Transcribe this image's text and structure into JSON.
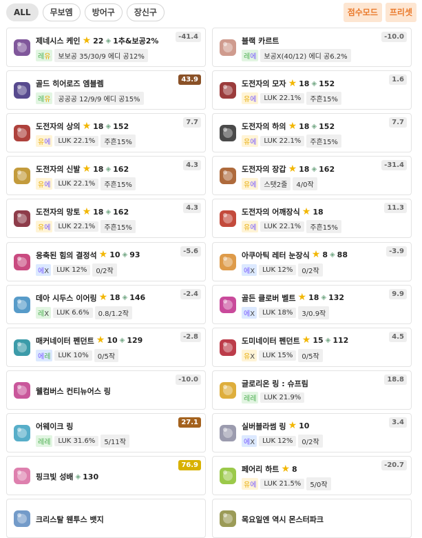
{
  "tabs": [
    "ALL",
    "무보엠",
    "방어구",
    "장신구"
  ],
  "modes": [
    "점수모드",
    "프리셋"
  ],
  "items": [
    {
      "name": "제네시스 케인",
      "stars": "22",
      "gem": "1추&보공2%",
      "pot_l": "레",
      "pot_r": "유",
      "chips": [
        "보보공 35/30/9 에디 공12%"
      ],
      "score": "-41.4",
      "scoreStyle": "",
      "icon": "cane-icon",
      "iconColor": "#6a3a8a"
    },
    {
      "name": "블랙 카르트",
      "stars": "",
      "gem": "",
      "pot_l": "레",
      "pot_r": "에",
      "chips": [
        "보공X(40/12) 에디 공6.2%"
      ],
      "score": "-10.0",
      "scoreStyle": "",
      "icon": "card-icon",
      "iconColor": "#c78a7a"
    },
    {
      "name": "골드 히어로즈 엠블렘",
      "stars": "",
      "gem": "",
      "pot_l": "레",
      "pot_r": "유",
      "chips": [
        "공공공 12/9/9 에디 공15%"
      ],
      "score": "43.9",
      "scoreStyle": "hi1",
      "icon": "emblem-icon",
      "iconColor": "#3a2a7a"
    },
    {
      "name": "도전자의 모자",
      "stars": "18",
      "gem": "152",
      "pot_l": "유",
      "pot_r": "에",
      "chips": [
        "LUK 22.1%",
        "주흔15%"
      ],
      "score": "1.6",
      "scoreStyle": "",
      "icon": "hat-icon",
      "iconColor": "#8a1a1a"
    },
    {
      "name": "도전자의 상의",
      "stars": "18",
      "gem": "152",
      "pot_l": "유",
      "pot_r": "에",
      "chips": [
        "LUK 22.1%",
        "주흔15%"
      ],
      "score": "7.7",
      "scoreStyle": "",
      "icon": "top-icon",
      "iconColor": "#a0201a"
    },
    {
      "name": "도전자의 하의",
      "stars": "18",
      "gem": "152",
      "pot_l": "유",
      "pot_r": "에",
      "chips": [
        "LUK 22.1%",
        "주흔15%"
      ],
      "score": "7.7",
      "scoreStyle": "",
      "icon": "bottom-icon",
      "iconColor": "#2a2a2a"
    },
    {
      "name": "도전자의 신발",
      "stars": "18",
      "gem": "162",
      "pot_l": "유",
      "pot_r": "에",
      "chips": [
        "LUK 22.1%",
        "주흔15%"
      ],
      "score": "4.3",
      "scoreStyle": "",
      "icon": "shoes-icon",
      "iconColor": "#b88a1a"
    },
    {
      "name": "도전자의 장갑",
      "stars": "18",
      "gem": "162",
      "pot_l": "유",
      "pot_r": "에",
      "chips": [
        "스탯2줄",
        "4/0작"
      ],
      "score": "-31.4",
      "scoreStyle": "",
      "icon": "gloves-icon",
      "iconColor": "#a0501a"
    },
    {
      "name": "도전자의 망토",
      "stars": "18",
      "gem": "162",
      "pot_l": "유",
      "pot_r": "에",
      "chips": [
        "LUK 22.1%",
        "주흔15%"
      ],
      "score": "4.3",
      "scoreStyle": "",
      "icon": "cape-icon",
      "iconColor": "#7a1a2a"
    },
    {
      "name": "도전자의 어깨장식",
      "stars": "18",
      "gem": "",
      "pot_l": "유",
      "pot_r": "에",
      "chips": [
        "LUK 22.1%",
        "주흔15%"
      ],
      "score": "11.3",
      "scoreStyle": "",
      "icon": "shoulder-icon",
      "iconColor": "#b82a1a"
    },
    {
      "name": "응축된 힘의 결정석",
      "stars": "10",
      "gem": "93",
      "pot_l": "에",
      "pot_r": "X",
      "chips": [
        "LUK 12%",
        "0/2작"
      ],
      "score": "-5.6",
      "scoreStyle": "",
      "icon": "crystal-icon",
      "iconColor": "#c02a6a"
    },
    {
      "name": "아쿠아틱 레터 눈장식",
      "stars": "8",
      "gem": "88",
      "pot_l": "에",
      "pot_r": "X",
      "chips": [
        "LUK 12%",
        "0/2작"
      ],
      "score": "-3.9",
      "scoreStyle": "",
      "icon": "eye-accessory-icon",
      "iconColor": "#d88a2a"
    },
    {
      "name": "데아 시두스 이어링",
      "stars": "18",
      "gem": "146",
      "pot_l": "레",
      "pot_r": "X",
      "chips": [
        "LUK 6.6%",
        "0.8/1.2작"
      ],
      "score": "-2.4",
      "scoreStyle": "",
      "icon": "earring-icon",
      "iconColor": "#3a8ac0"
    },
    {
      "name": "골든 클로버 벨트",
      "stars": "18",
      "gem": "132",
      "pot_l": "에",
      "pot_r": "X",
      "chips": [
        "LUK 18%",
        "3/0.9작"
      ],
      "score": "9.9",
      "scoreStyle": "",
      "icon": "belt-icon",
      "iconColor": "#c02a8a"
    },
    {
      "name": "매커네이터 펜던트",
      "stars": "10",
      "gem": "129",
      "pot_l": "에",
      "pot_r": "레",
      "chips": [
        "LUK 10%",
        "0/5작"
      ],
      "score": "-2.8",
      "scoreStyle": "",
      "icon": "pendant-icon",
      "iconColor": "#1a8a9a"
    },
    {
      "name": "도미네이터 펜던트",
      "stars": "15",
      "gem": "112",
      "pot_l": "유",
      "pot_r": "X",
      "chips": [
        "LUK 15%",
        "0/5작"
      ],
      "score": "4.5",
      "scoreStyle": "",
      "icon": "pendant2-icon",
      "iconColor": "#b01a2a"
    },
    {
      "name": "웰컴버스 컨티뉴어스 링",
      "stars": "",
      "gem": "",
      "pot_l": "",
      "pot_r": "",
      "chips": [],
      "score": "-10.0",
      "scoreStyle": "",
      "icon": "ring-icon",
      "iconColor": "#c03a8a"
    },
    {
      "name": "글로리온 링 : 슈프림",
      "stars": "",
      "gem": "",
      "pot_l": "레",
      "pot_r": "레",
      "chips": [
        "LUK 21.9%"
      ],
      "score": "18.8",
      "scoreStyle": "",
      "icon": "ring2-icon",
      "iconColor": "#d8a01a"
    },
    {
      "name": "어웨이크 링",
      "stars": "",
      "gem": "",
      "pot_l": "레",
      "pot_r": "레",
      "chips": [
        "LUK 31.6%",
        "5/11작"
      ],
      "score": "27.1",
      "scoreStyle": "hi2",
      "icon": "ring3-icon",
      "iconColor": "#3aa0c0"
    },
    {
      "name": "실버블라썸 링",
      "stars": "10",
      "gem": "",
      "pot_l": "에",
      "pot_r": "X",
      "chips": [
        "LUK 12%",
        "0/2작"
      ],
      "score": "3.4",
      "scoreStyle": "",
      "icon": "ring4-icon",
      "iconColor": "#8a8aa0"
    },
    {
      "name": "핑크빛 성배",
      "stars": "",
      "gem": "130",
      "pot_l": "",
      "pot_r": "",
      "chips": [],
      "score": "76.9",
      "scoreStyle": "hi3",
      "icon": "chalice-icon",
      "iconColor": "#d86aa0"
    },
    {
      "name": "페어리 하트",
      "stars": "8",
      "gem": "",
      "pot_l": "유",
      "pot_r": "에",
      "chips": [
        "LUK 21.5%",
        "5/0작"
      ],
      "score": "-20.7",
      "scoreStyle": "",
      "icon": "heart-icon",
      "iconColor": "#8ac02a"
    },
    {
      "name": "크리스탈 웬투스 뱃지",
      "stars": "",
      "gem": "",
      "pot_l": "",
      "pot_r": "",
      "chips": [],
      "score": "",
      "scoreStyle": "",
      "icon": "badge-icon",
      "iconColor": "#5a8ac0"
    },
    {
      "name": "목요일엔 역시 몬스터파크",
      "stars": "",
      "gem": "",
      "pot_l": "",
      "pot_r": "",
      "chips": [],
      "score": "",
      "scoreStyle": "",
      "icon": "medal-icon",
      "iconColor": "#8a8a3a"
    }
  ],
  "potColors": {
    "레": "#4caf50",
    "유": "#e6a800",
    "에": "#7a5cff",
    "X": "#444444"
  },
  "potBg": {
    "레": "#e2f5e2",
    "유": "#fff4d6",
    "에": "#dce9ff",
    "X": "#ffffff"
  }
}
